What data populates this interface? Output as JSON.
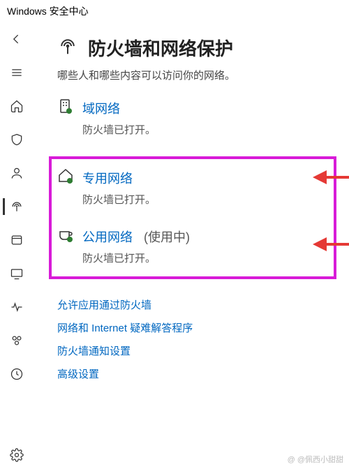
{
  "window_title": "Windows 安全中心",
  "header": {
    "title": "防火墙和网络保护",
    "subtitle": "哪些人和哪些内容可以访问你的网络。"
  },
  "networks": {
    "domain": {
      "label": "域网络",
      "status": "防火墙已打开。"
    },
    "private": {
      "label": "专用网络",
      "status": "防火墙已打开。"
    },
    "public": {
      "label": "公用网络",
      "in_use": "(使用中)",
      "status": "防火墙已打开。"
    }
  },
  "links": {
    "allow_app": "允许应用通过防火墙",
    "troubleshoot": "网络和 Internet 疑难解答程序",
    "notify": "防火墙通知设置",
    "advanced": "高级设置"
  },
  "watermark": "@ @佩西小甜甜"
}
